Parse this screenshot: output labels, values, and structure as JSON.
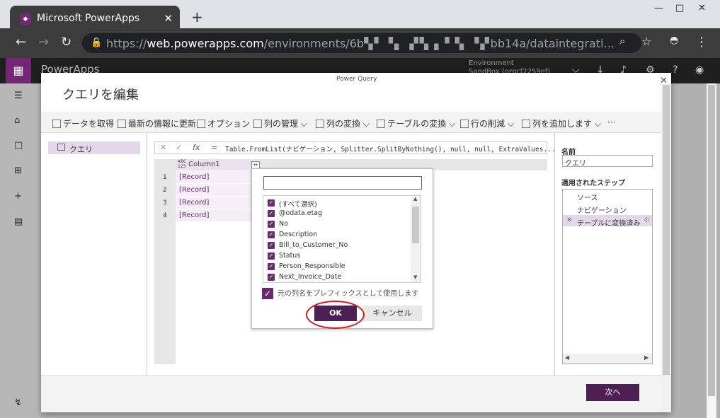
{
  "browser": {
    "tab_title": "Microsoft PowerApps",
    "tab_close": "✕",
    "new_tab": "+",
    "url_prefix": "https://",
    "url_host": "web.powerapps.com",
    "url_path": "/environments/6b",
    "url_tail": "bb14a/dataintegrati...",
    "window_controls": [
      "—",
      "□",
      "✕"
    ]
  },
  "app": {
    "name": "PowerApps",
    "environment_label": "Environment",
    "environment_value": "SandBox (orgcf2259ef)"
  },
  "modal": {
    "window_title": "Power Query",
    "heading": "クエリを編集",
    "close": "✕"
  },
  "ribbon": [
    {
      "label": "データを取得"
    },
    {
      "label": "最新の情報に更新"
    },
    {
      "label": "オプション"
    },
    {
      "label": "列の管理 ⌵"
    },
    {
      "label": "列の変換 ⌵"
    },
    {
      "label": "テーブルの変換 ⌵"
    },
    {
      "label": "行の削減 ⌵"
    },
    {
      "label": "列を追加します ⌵"
    },
    {
      "label": "···"
    }
  ],
  "queries": {
    "item": "クエリ"
  },
  "formula": {
    "cancel": "✕",
    "commit": "✓",
    "fx": "fx",
    "equals": "=",
    "code": "Table.FromList(ナビゲーション, Splitter.SplitByNothing(), null, null, ExtraValues..."
  },
  "grid": {
    "column_type": "ABC\n123",
    "column_name": "Column1",
    "expand_icon": "↔",
    "rows": [
      {
        "num": "1",
        "value": "[Record]"
      },
      {
        "num": "2",
        "value": "[Record]"
      },
      {
        "num": "3",
        "value": "[Record]"
      },
      {
        "num": "4",
        "value": "[Record]"
      }
    ]
  },
  "dropdown": {
    "search_value": "",
    "items": [
      "(すべて選択)",
      "@odata.etag",
      "No",
      "Description",
      "Bill_to_Customer_No",
      "Status",
      "Person_Responsible",
      "Next_Invoice_Date"
    ],
    "prefix_label": "元の列名をプレフィックスとして使用します",
    "ok": "OK",
    "cancel": "キャンセル"
  },
  "settings": {
    "name_label": "名前",
    "name_value": "クエリ",
    "steps_label": "適用されたステップ",
    "steps": [
      "ソース",
      "ナビゲーション",
      "テーブルに変換済み"
    ]
  },
  "footer": {
    "next": "次へ"
  },
  "colors": {
    "accent": "#742774",
    "button": "#4e1f52",
    "highlight_circle": "#e0141e"
  }
}
